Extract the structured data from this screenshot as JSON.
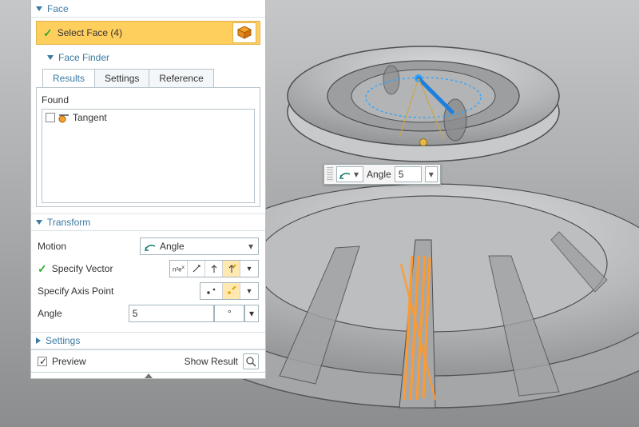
{
  "face": {
    "title": "Face",
    "select_label": "Select Face (4)"
  },
  "face_finder": {
    "title": "Face Finder",
    "tabs": {
      "results": "Results",
      "settings": "Settings",
      "reference": "Reference"
    },
    "found_label": "Found",
    "items": [
      {
        "label": "Tangent"
      }
    ]
  },
  "transform": {
    "title": "Transform",
    "motion_label": "Motion",
    "motion_value": "Angle",
    "specify_vector": "Specify Vector",
    "specify_axis": "Specify Axis Point",
    "angle_label": "Angle",
    "angle_value": "5",
    "angle_unit": "°"
  },
  "settings": {
    "title": "Settings"
  },
  "footer": {
    "preview": "Preview",
    "show_result": "Show Result"
  },
  "float": {
    "label": "Angle",
    "value": "5"
  }
}
